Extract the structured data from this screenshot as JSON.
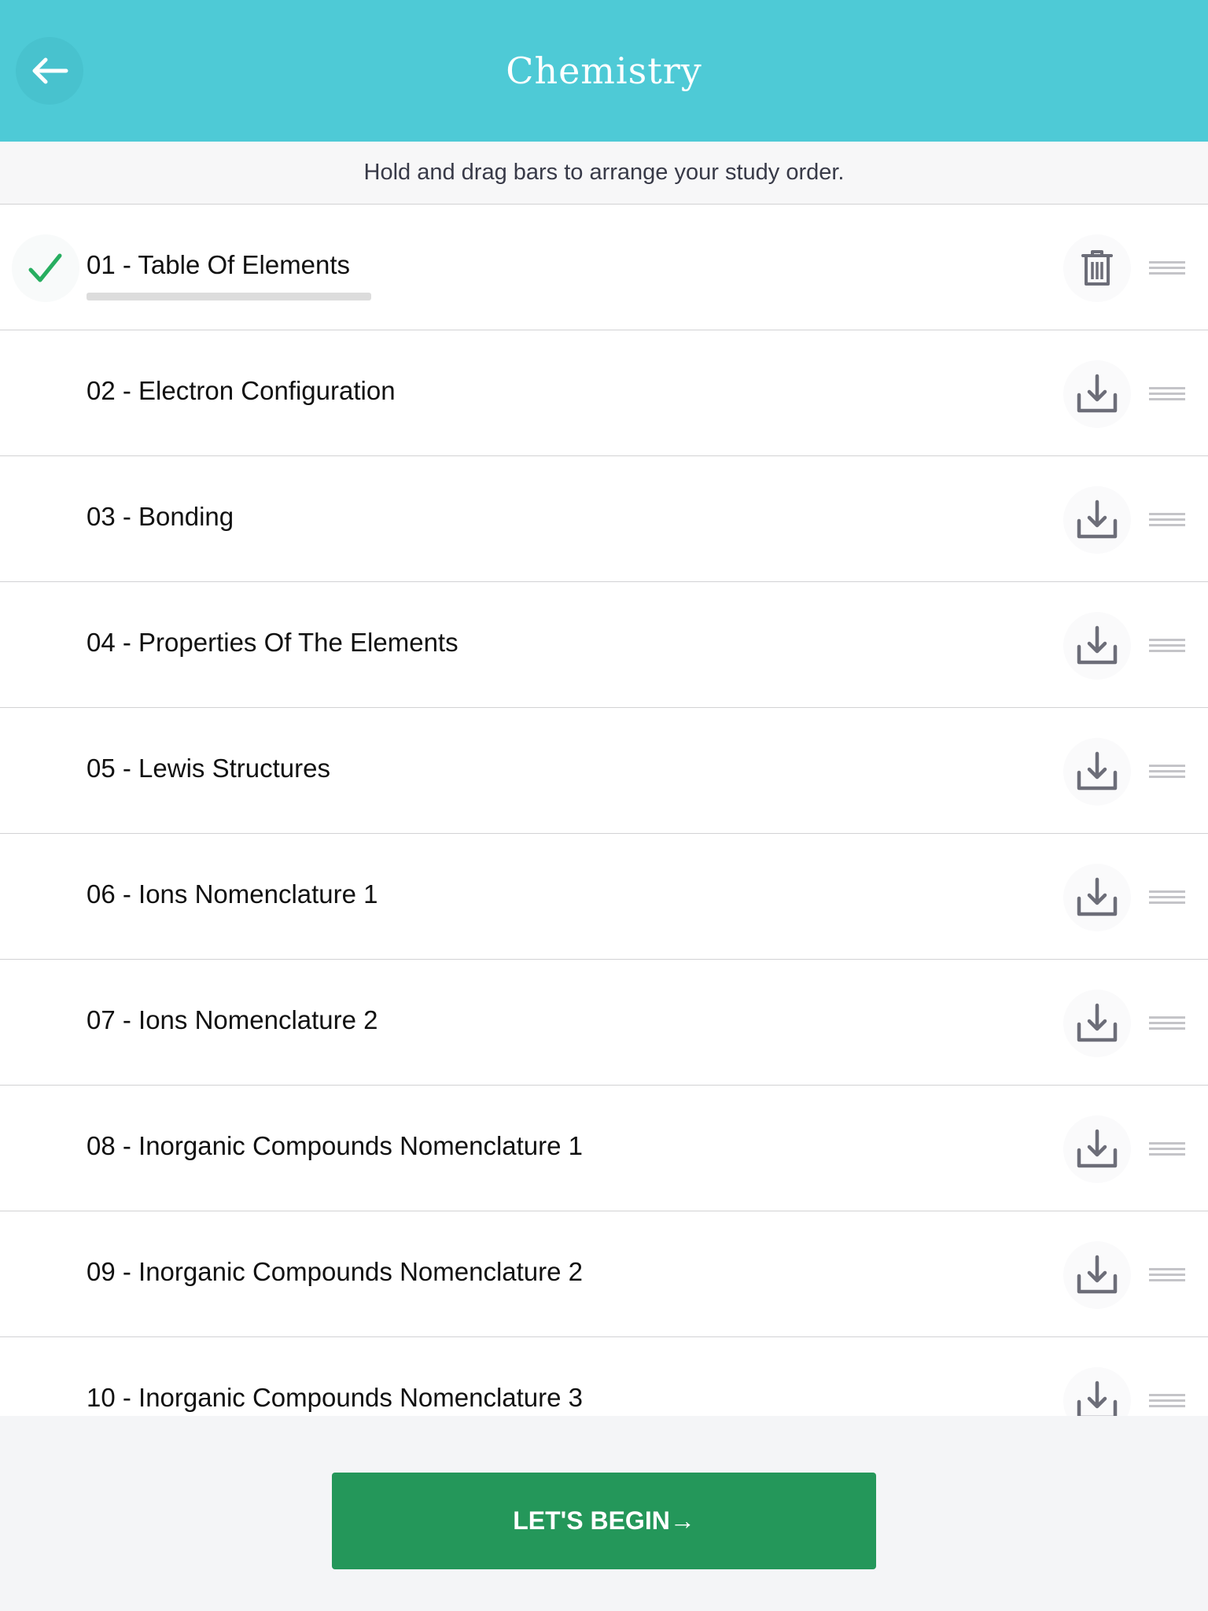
{
  "header": {
    "title": "Chemistry",
    "back_icon": "arrow-left-icon",
    "background_color": "#4ecad6"
  },
  "subheader": {
    "text": "Hold and drag bars to arrange your study order."
  },
  "list": {
    "items": [
      {
        "label": "01 - Table Of Elements",
        "completed": true,
        "status_icon": "checkmark-icon",
        "action": "delete",
        "action_icon": "trash-icon",
        "progress": 1.0
      },
      {
        "label": "02 - Electron Configuration",
        "completed": false,
        "action": "download",
        "action_icon": "download-icon"
      },
      {
        "label": "03 - Bonding",
        "completed": false,
        "action": "download",
        "action_icon": "download-icon"
      },
      {
        "label": "04 - Properties Of The Elements",
        "completed": false,
        "action": "download",
        "action_icon": "download-icon"
      },
      {
        "label": "05 - Lewis Structures",
        "completed": false,
        "action": "download",
        "action_icon": "download-icon"
      },
      {
        "label": "06 - Ions Nomenclature 1",
        "completed": false,
        "action": "download",
        "action_icon": "download-icon"
      },
      {
        "label": "07 - Ions Nomenclature 2",
        "completed": false,
        "action": "download",
        "action_icon": "download-icon"
      },
      {
        "label": "08 - Inorganic Compounds Nomenclature 1",
        "completed": false,
        "action": "download",
        "action_icon": "download-icon"
      },
      {
        "label": "09 - Inorganic Compounds Nomenclature 2",
        "completed": false,
        "action": "download",
        "action_icon": "download-icon"
      },
      {
        "label": "10 - Inorganic Compounds Nomenclature 3",
        "completed": false,
        "action": "download",
        "action_icon": "download-icon"
      }
    ]
  },
  "footer": {
    "begin_label": "LET'S BEGIN→",
    "button_color": "#24975a"
  },
  "colors": {
    "check": "#27ae60",
    "icon": "#6c6d78",
    "drag_handle": "#c4c4c8"
  }
}
